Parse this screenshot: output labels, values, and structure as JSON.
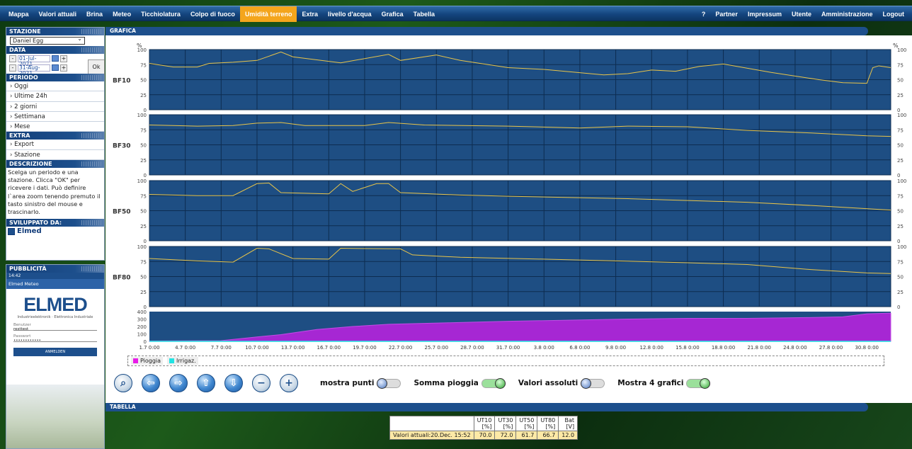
{
  "nav": {
    "left": [
      "Mappa",
      "Valori attuali",
      "Brina",
      "Meteo",
      "Ticchiolatura",
      "Colpo di fuoco",
      "Umidità terreno",
      "Extra",
      "livello d'acqua",
      "Grafica",
      "Tabella"
    ],
    "active": "Umidità terreno",
    "right": [
      "?",
      "Partner",
      "Impressum",
      "Utente",
      "Amministrazione",
      "Logout"
    ]
  },
  "sidebar": {
    "stazione_head": "STAZIONE",
    "station": "Daniel Egg",
    "data_head": "DATA",
    "date_from": "01-Jul-2021",
    "date_to": "31-Aug-2021",
    "minus": "-",
    "plus": "+",
    "ok": "Ok",
    "periodo_head": "PERIODO",
    "periodo": [
      "Oggi",
      "Ultime 24h",
      "2 giorni",
      "Settimana",
      "Mese"
    ],
    "extra_head": "EXTRA",
    "extra": [
      "Export",
      "Stazione"
    ],
    "descr_head": "DESCRIZIONE",
    "descr": "Scelga un periodo e una stazione. Clicca \"OK\" per ricevere i dati. Può definire l`area zoom tenendo premuto il tasto sinistro del mouse e trascinarlo.",
    "svil_head": "SVILUPPATO DA:",
    "svil_name": "Elmed"
  },
  "ad": {
    "head": "PUBBLICITÀ",
    "time": "14:42",
    "app_title": "Elmed Meteo",
    "brand": "ELMED",
    "brand_sub": "Industrieelektronik · Elettronica Industriale",
    "user_label": "Benutzer",
    "user_value": "resttest",
    "pass_label": "Passwort",
    "pass_value": "••••••••••••",
    "login": "ANMELDEN"
  },
  "grafica_head": "GRAFICA",
  "tabella_head": "TABELLA",
  "chart_data": {
    "type": "line",
    "unit": "%",
    "ylim": [
      0,
      100
    ],
    "yticks": [
      0,
      25,
      50,
      75,
      100
    ],
    "xlabels": [
      "1.7 0:00",
      "4.7 0:00",
      "7.7 0:00",
      "10.7 0:00",
      "13.7 0:00",
      "16.7 0:00",
      "19.7 0:00",
      "22.7 0:00",
      "25.7 0:00",
      "28.7 0:00",
      "31.7 0:00",
      "3.8 0:00",
      "6.8 0:00",
      "9.8 0:00",
      "12.8 0:00",
      "15.8 0:00",
      "18.8 0:00",
      "21.8 0:00",
      "24.8 0:00",
      "27.8 0:00",
      "30.8 0:00"
    ],
    "x_days": 62,
    "series": [
      {
        "name": "BF10",
        "points": [
          [
            0,
            77
          ],
          [
            1,
            74
          ],
          [
            2,
            71
          ],
          [
            4,
            71
          ],
          [
            5,
            77
          ],
          [
            7,
            79
          ],
          [
            9,
            82
          ],
          [
            11,
            96
          ],
          [
            12,
            88
          ],
          [
            16,
            78
          ],
          [
            20,
            92
          ],
          [
            21,
            82
          ],
          [
            24,
            91
          ],
          [
            26,
            82
          ],
          [
            30,
            70
          ],
          [
            33,
            67
          ],
          [
            38,
            58
          ],
          [
            40,
            60
          ],
          [
            42,
            66
          ],
          [
            44,
            64
          ],
          [
            46,
            72
          ],
          [
            48,
            76
          ],
          [
            52,
            62
          ],
          [
            56,
            50
          ],
          [
            58,
            45
          ],
          [
            60,
            44
          ],
          [
            60.5,
            70
          ],
          [
            61,
            73
          ],
          [
            62,
            70
          ]
        ]
      },
      {
        "name": "BF30",
        "points": [
          [
            0,
            83
          ],
          [
            4,
            81
          ],
          [
            7,
            82
          ],
          [
            9,
            86
          ],
          [
            11,
            87
          ],
          [
            13,
            82
          ],
          [
            18,
            82
          ],
          [
            20,
            87
          ],
          [
            23,
            83
          ],
          [
            30,
            81
          ],
          [
            36,
            78
          ],
          [
            40,
            81
          ],
          [
            45,
            80
          ],
          [
            50,
            74
          ],
          [
            55,
            70
          ],
          [
            60,
            65
          ],
          [
            62,
            64
          ]
        ]
      },
      {
        "name": "BF50",
        "points": [
          [
            0,
            77
          ],
          [
            4,
            75
          ],
          [
            7,
            75
          ],
          [
            9,
            95
          ],
          [
            10,
            96
          ],
          [
            11,
            80
          ],
          [
            15,
            78
          ],
          [
            16,
            95
          ],
          [
            17,
            82
          ],
          [
            19,
            95
          ],
          [
            20,
            95
          ],
          [
            21,
            80
          ],
          [
            26,
            76
          ],
          [
            30,
            74
          ],
          [
            40,
            70
          ],
          [
            50,
            64
          ],
          [
            56,
            58
          ],
          [
            62,
            51
          ]
        ]
      },
      {
        "name": "BF80",
        "points": [
          [
            0,
            80
          ],
          [
            4,
            76
          ],
          [
            7,
            74
          ],
          [
            9,
            97
          ],
          [
            10,
            96
          ],
          [
            12,
            80
          ],
          [
            15,
            79
          ],
          [
            16,
            97
          ],
          [
            21,
            96
          ],
          [
            22,
            86
          ],
          [
            26,
            82
          ],
          [
            35,
            78
          ],
          [
            45,
            73
          ],
          [
            50,
            70
          ],
          [
            55,
            62
          ],
          [
            60,
            56
          ],
          [
            62,
            55
          ]
        ]
      }
    ],
    "rain": {
      "name": "Pioggia",
      "ylim": [
        0,
        400
      ],
      "yticks": [
        0,
        100,
        200,
        300,
        400
      ],
      "points": [
        [
          0,
          5
        ],
        [
          6,
          10
        ],
        [
          9,
          60
        ],
        [
          11,
          90
        ],
        [
          14,
          160
        ],
        [
          17,
          200
        ],
        [
          20,
          230
        ],
        [
          25,
          250
        ],
        [
          30,
          270
        ],
        [
          35,
          285
        ],
        [
          40,
          300
        ],
        [
          45,
          310
        ],
        [
          50,
          310
        ],
        [
          55,
          320
        ],
        [
          58,
          330
        ],
        [
          60,
          370
        ],
        [
          62,
          380
        ]
      ]
    },
    "legend": [
      "Pioggia",
      "Irrigaz."
    ],
    "legend_colors": [
      "#e81ce8",
      "#21e3e3"
    ]
  },
  "toggles": [
    {
      "label": "mostra punti",
      "on": false
    },
    {
      "label": "Somma pioggia",
      "on": true
    },
    {
      "label": "Valori assoluti",
      "on": false
    },
    {
      "label": "Mostra 4 grafici",
      "on": true
    }
  ],
  "colors": {
    "chart_bg": "#1e4e83",
    "line": "#e8c44a",
    "rain": "#a627d3",
    "nav_active": "#f4a51c"
  },
  "table": {
    "headers": [
      [
        "UT10",
        "[%]"
      ],
      [
        "UT30",
        "[%]"
      ],
      [
        "UT50",
        "[%]"
      ],
      [
        "UT80",
        "[%]"
      ],
      [
        "Bat",
        "[V]"
      ]
    ],
    "row_label": "Valori attuali:20.Dec. 15:52",
    "row_values": [
      "70.0",
      "72.0",
      "61.7",
      "66.7",
      "12.0"
    ]
  }
}
